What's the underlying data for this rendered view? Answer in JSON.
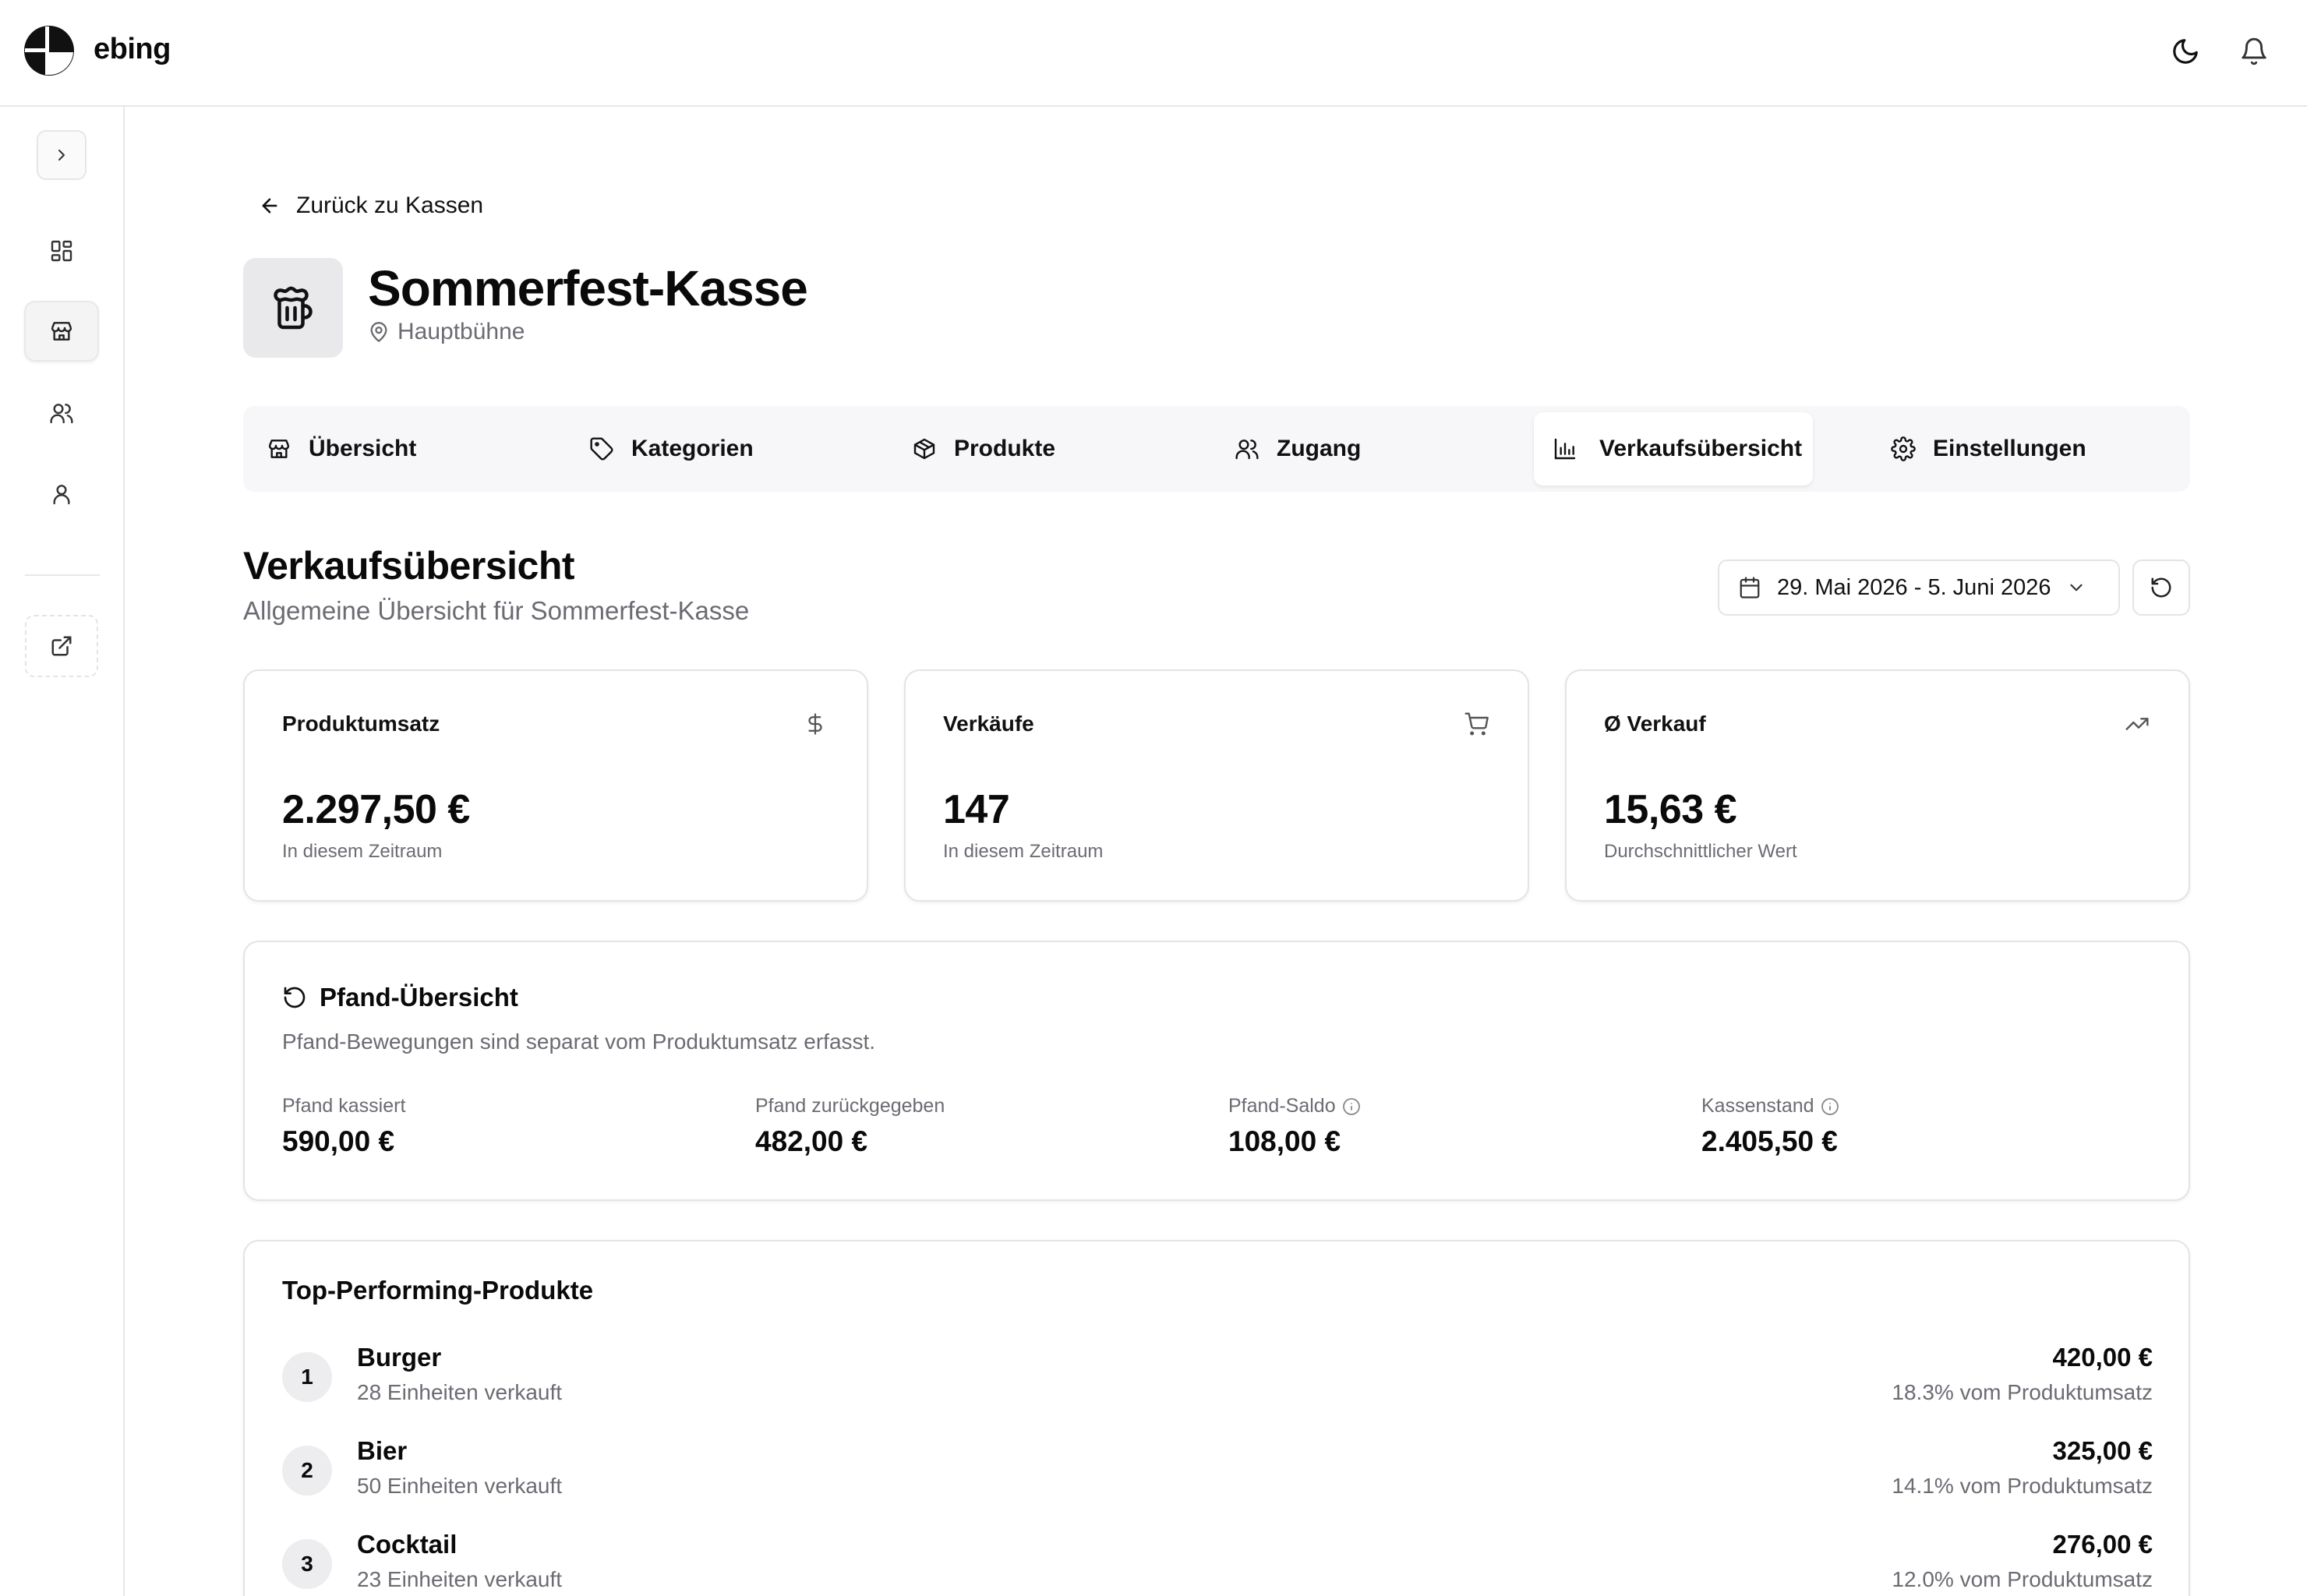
{
  "app": {
    "brand": "ebing"
  },
  "back_link": {
    "label": "Zurück zu Kassen"
  },
  "register": {
    "title": "Sommerfest-Kasse",
    "location": "Hauptbühne"
  },
  "tabs": [
    {
      "label": "Übersicht",
      "icon": "store-icon"
    },
    {
      "label": "Kategorien",
      "icon": "tag-icon"
    },
    {
      "label": "Produkte",
      "icon": "box-icon"
    },
    {
      "label": "Zugang",
      "icon": "users-icon"
    },
    {
      "label": "Verkaufsübersicht",
      "icon": "bar-chart-icon",
      "active": true
    },
    {
      "label": "Einstellungen",
      "icon": "gear-icon"
    }
  ],
  "section": {
    "title": "Verkaufsübersicht",
    "subtitle": "Allgemeine Übersicht für Sommerfest-Kasse",
    "date_range": "29. Mai 2026 - 5. Juni 2026"
  },
  "stats": [
    {
      "label": "Produktumsatz",
      "value": "2.297,50 €",
      "note": "In diesem Zeitraum",
      "icon": "dollar-icon"
    },
    {
      "label": "Verkäufe",
      "value": "147",
      "note": "In diesem Zeitraum",
      "icon": "cart-icon"
    },
    {
      "label": "Ø Verkauf",
      "value": "15,63 €",
      "note": "Durchschnittlicher Wert",
      "icon": "trending-up-icon"
    }
  ],
  "pfand": {
    "title": "Pfand-Übersicht",
    "description": "Pfand-Bewegungen sind separat vom Produktumsatz erfasst.",
    "items": [
      {
        "label": "Pfand kassiert",
        "value": "590,00 €"
      },
      {
        "label": "Pfand zurückgegeben",
        "value": "482,00 €"
      },
      {
        "label": "Pfand-Saldo",
        "value": "108,00 €",
        "info": true
      },
      {
        "label": "Kassenstand",
        "value": "2.405,50 €",
        "info": true
      }
    ]
  },
  "top_products": {
    "title": "Top-Performing-Produkte",
    "items": [
      {
        "rank": "1",
        "name": "Burger",
        "units": "28 Einheiten verkauft",
        "revenue": "420,00 €",
        "share": "18.3% vom Produktumsatz"
      },
      {
        "rank": "2",
        "name": "Bier",
        "units": "50 Einheiten verkauft",
        "revenue": "325,00 €",
        "share": "14.1% vom Produktumsatz"
      },
      {
        "rank": "3",
        "name": "Cocktail",
        "units": "23 Einheiten verkauft",
        "revenue": "276,00 €",
        "share": "12.0% vom Produktumsatz"
      }
    ]
  }
}
